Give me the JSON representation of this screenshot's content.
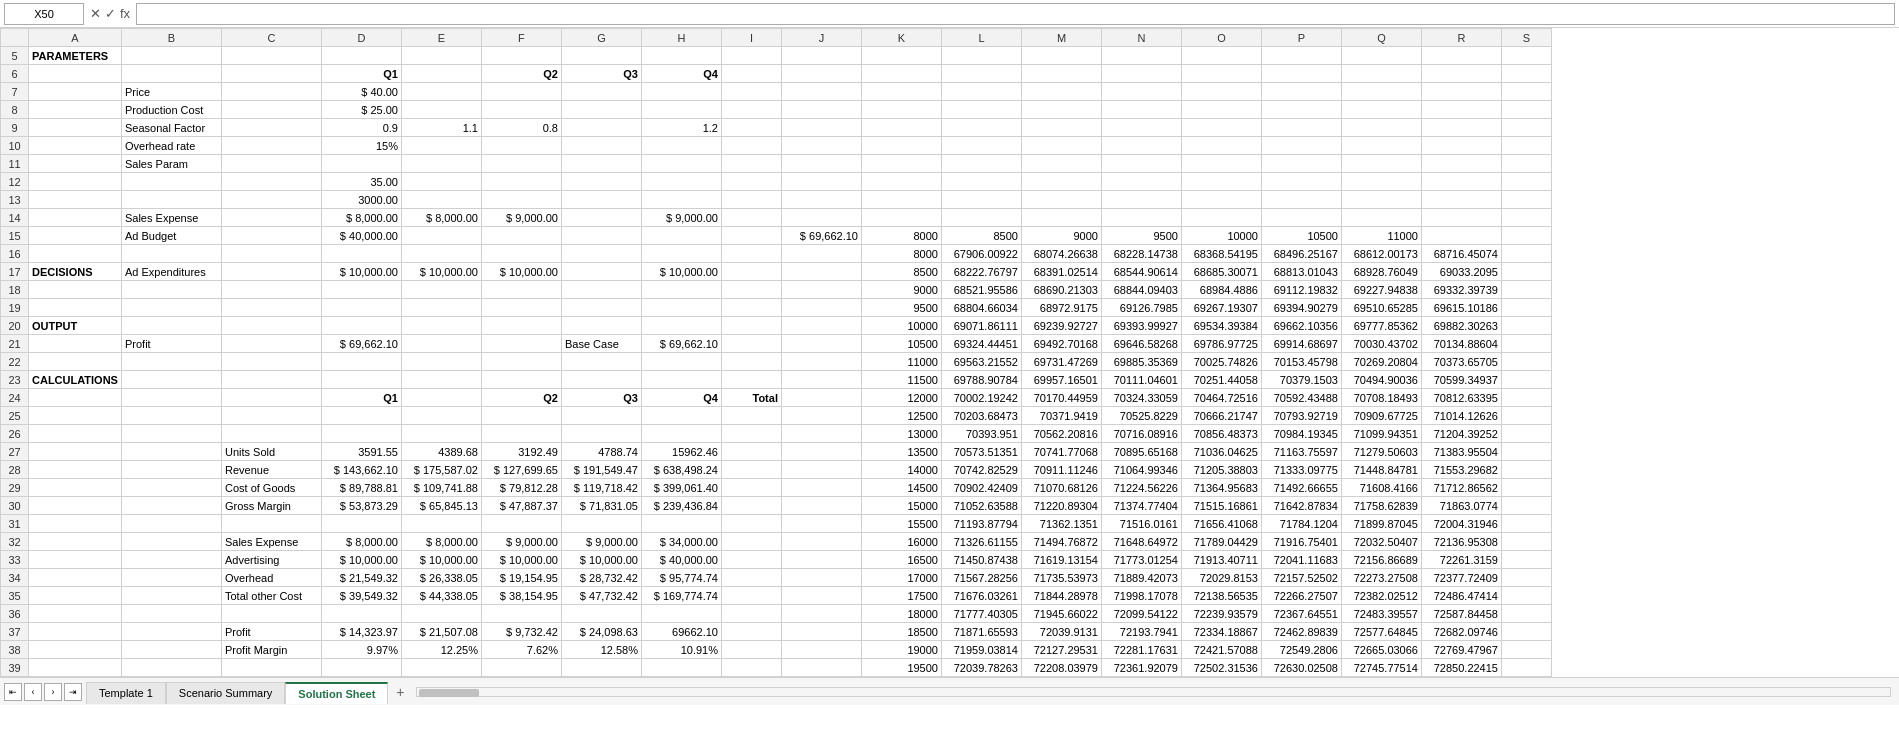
{
  "formulaBar": {
    "nameBox": "X50",
    "cancelIcon": "✕",
    "confirmIcon": "✓",
    "functionIcon": "fx",
    "formula": ""
  },
  "tabs": [
    {
      "id": "template1",
      "label": "Template 1",
      "active": false
    },
    {
      "id": "scenario-summary",
      "label": "Scenario Summary",
      "active": false
    },
    {
      "id": "solution-sheet",
      "label": "Solution Sheet",
      "active": true
    }
  ],
  "columns": [
    "",
    "A",
    "B",
    "C",
    "D",
    "E",
    "F",
    "G",
    "H",
    "I",
    "J",
    "K",
    "L",
    "M",
    "N",
    "O",
    "P",
    "Q",
    "R",
    "S"
  ],
  "rows": {
    "5": {
      "A": "PARAMETERS"
    },
    "6": {
      "D": "Q1",
      "F": "Q2",
      "G": "Q3",
      "H": "Q4"
    },
    "7": {
      "B": "Price",
      "D": "$    40.00"
    },
    "8": {
      "B": "Production Cost",
      "D": "$    25.00"
    },
    "9": {
      "B": "Seasonal Factor",
      "D": "0.9",
      "E": "1.1",
      "F": "0.8",
      "H": "1.2"
    },
    "10": {
      "B": "Overhead rate",
      "D": "15%"
    },
    "11": {
      "B": "Sales Param"
    },
    "12": {
      "D": "35.00"
    },
    "13": {
      "D": "3000.00"
    },
    "14": {
      "B": "Sales Expense",
      "D": "$  8,000.00",
      "E": "$  8,000.00",
      "F": "$  9,000.00",
      "H": "$  9,000.00"
    },
    "15": {
      "B": "Ad Budget",
      "D": "$ 40,000.00",
      "J": "$  69,662.10",
      "K": "8000",
      "L": "8500",
      "M": "9000",
      "N": "9500",
      "O": "10000",
      "P": "10500",
      "Q": "11000"
    },
    "16": {
      "K": "8000",
      "L": "67906.00922",
      "M": "68074.26638",
      "N": "68228.14738",
      "O": "68368.54195",
      "P": "68496.25167",
      "Q": "68612.00173",
      "R": "68716.45074"
    },
    "17": {
      "A": "DECISIONS",
      "B": "Ad Expenditures",
      "D": "$ 10,000.00",
      "E": "$ 10,000.00",
      "F": "$ 10,000.00",
      "H": "$ 10,000.00",
      "K": "8500",
      "L": "68222.76797",
      "M": "68391.02514",
      "N": "68544.90614",
      "O": "68685.30071",
      "P": "68813.01043",
      "Q": "68928.76049",
      "R": "69033.2095"
    },
    "18": {
      "K": "9000",
      "L": "68521.95586",
      "M": "68690.21303",
      "N": "68844.09403",
      "O": "68984.4886",
      "P": "69112.19832",
      "Q": "69227.94838",
      "R": "69332.39739"
    },
    "19": {
      "K": "9500",
      "L": "68804.66034",
      "M": "68972.9175",
      "N": "69126.7985",
      "O": "69267.19307",
      "P": "69394.90279",
      "Q": "69510.65285",
      "R": "69615.10186"
    },
    "20": {
      "A": "OUTPUT",
      "K": "10000",
      "L": "69071.86111",
      "M": "69239.92727",
      "N": "69393.99927",
      "O": "69534.39384",
      "P": "69662.10356",
      "Q": "69777.85362",
      "R": "69882.30263"
    },
    "21": {
      "B": "Profit",
      "D": "$  69,662.10",
      "G": "Base Case",
      "H": "$  69,662.10",
      "K": "10500",
      "L": "69324.44451",
      "M": "69492.70168",
      "N": "69646.58268",
      "O": "69786.97725",
      "P": "69914.68697",
      "Q": "70030.43702",
      "R": "70134.88604"
    },
    "22": {
      "K": "11000",
      "L": "69563.21552",
      "M": "69731.47269",
      "N": "69885.35369",
      "O": "70025.74826",
      "P": "70153.45798",
      "Q": "70269.20804",
      "R": "70373.65705"
    },
    "23": {
      "A": "CALCULATIONS",
      "K": "11500",
      "L": "69788.90784",
      "M": "69957.16501",
      "N": "70111.04601",
      "O": "70251.44058",
      "P": "70379.1503",
      "Q": "70494.90036",
      "R": "70599.34937"
    },
    "24": {
      "D": "Q1",
      "F": "Q2",
      "G": "Q3",
      "H": "Q4",
      "I": "Total",
      "K": "12000",
      "L": "70002.19242",
      "M": "70170.44959",
      "N": "70324.33059",
      "O": "70464.72516",
      "P": "70592.43488",
      "Q": "70708.18493",
      "R": "70812.63395"
    },
    "25": {
      "K": "12500",
      "L": "70203.68473",
      "M": "70371.9419",
      "N": "70525.8229",
      "O": "70666.21747",
      "P": "70793.92719",
      "Q": "70909.67725",
      "R": "71014.12626"
    },
    "26": {
      "K": "13000",
      "L": "70393.951",
      "M": "70562.20816",
      "N": "70716.08916",
      "O": "70856.48373",
      "P": "70984.19345",
      "Q": "71099.94351",
      "R": "71204.39252"
    },
    "27": {
      "C": "Units Sold",
      "D": "3591.55",
      "E": "4389.68",
      "F": "3192.49",
      "G": "4788.74",
      "H": "15962.46",
      "K": "13500",
      "L": "70573.51351",
      "M": "70741.77068",
      "N": "70895.65168",
      "O": "71036.04625",
      "P": "71163.75597",
      "Q": "71279.50603",
      "R": "71383.95504"
    },
    "28": {
      "C": "Revenue",
      "D": "$ 143,662.10",
      "E": "$ 175,587.02",
      "F": "$ 127,699.65",
      "G": "$ 191,549.47",
      "H": "$ 638,498.24",
      "K": "14000",
      "L": "70742.82529",
      "M": "70911.11246",
      "N": "71064.99346",
      "O": "71205.38803",
      "P": "71333.09775",
      "Q": "71448.84781",
      "R": "71553.29682"
    },
    "29": {
      "C": "Cost of Goods",
      "D": "$  89,788.81",
      "E": "$ 109,741.88",
      "F": "$  79,812.28",
      "G": "$ 119,718.42",
      "H": "$ 399,061.40",
      "K": "14500",
      "L": "70902.42409",
      "M": "71070.68126",
      "N": "71224.56226",
      "O": "71364.95683",
      "P": "71492.66655",
      "Q": "71608.4166",
      "R": "71712.86562"
    },
    "30": {
      "C": "Gross Margin",
      "D": "$  53,873.29",
      "E": "$  65,845.13",
      "F": "$  47,887.37",
      "G": "$  71,831.05",
      "H": "$ 239,436.84",
      "K": "15000",
      "L": "71052.63588",
      "M": "71220.89304",
      "N": "71374.77404",
      "O": "71515.16861",
      "P": "71642.87834",
      "Q": "71758.62839",
      "R": "71863.0774"
    },
    "31": {
      "K": "15500",
      "L": "71193.87794",
      "M": "71362.1351",
      "N": "71516.0161",
      "O": "71656.41068",
      "P": "71784.1204",
      "Q": "71899.87045",
      "R": "72004.31946"
    },
    "32": {
      "C": "Sales Expense",
      "D": "$   8,000.00",
      "E": "$   8,000.00",
      "F": "$   9,000.00",
      "G": "$   9,000.00",
      "H": "$  34,000.00",
      "K": "16000",
      "L": "71326.61155",
      "M": "71494.76872",
      "N": "71648.64972",
      "O": "71789.04429",
      "P": "71916.75401",
      "Q": "72032.50407",
      "R": "72136.95308"
    },
    "33": {
      "C": "Advertising",
      "D": "$  10,000.00",
      "E": "$  10,000.00",
      "F": "$  10,000.00",
      "G": "$  10,000.00",
      "H": "$  40,000.00",
      "K": "16500",
      "L": "71450.87438",
      "M": "71619.13154",
      "N": "71773.01254",
      "O": "71913.40711",
      "P": "72041.11683",
      "Q": "72156.86689",
      "R": "72261.3159"
    },
    "34": {
      "C": "Overhead",
      "D": "$  21,549.32",
      "E": "$  26,338.05",
      "F": "$  19,154.95",
      "G": "$  28,732.42",
      "H": "$  95,774.74",
      "K": "17000",
      "L": "71567.28256",
      "M": "71735.53973",
      "N": "71889.42073",
      "O": "72029.8153",
      "P": "72157.52502",
      "Q": "72273.27508",
      "R": "72377.72409"
    },
    "35": {
      "C": "Total other Cost",
      "D": "$  39,549.32",
      "E": "$  44,338.05",
      "F": "$  38,154.95",
      "G": "$  47,732.42",
      "H": "$ 169,774.74",
      "K": "17500",
      "L": "71676.03261",
      "M": "71844.28978",
      "N": "71998.17078",
      "O": "72138.56535",
      "P": "72266.27507",
      "Q": "72382.02512",
      "R": "72486.47414"
    },
    "36": {
      "K": "18000",
      "L": "71777.40305",
      "M": "71945.66022",
      "N": "72099.54122",
      "O": "72239.93579",
      "P": "72367.64551",
      "Q": "72483.39557",
      "R": "72587.84458"
    },
    "37": {
      "C": "Profit",
      "D": "$  14,323.97",
      "E": "$  21,507.08",
      "F": "$   9,732.42",
      "G": "$  24,098.63",
      "H": "69662.10",
      "K": "18500",
      "L": "71871.65593",
      "M": "72039.9131",
      "N": "72193.7941",
      "O": "72334.18867",
      "P": "72462.89839",
      "Q": "72577.64845",
      "R": "72682.09746"
    },
    "38": {
      "C": "Profit Margin",
      "D": "9.97%",
      "E": "12.25%",
      "F": "7.62%",
      "G": "12.58%",
      "H": "10.91%",
      "K": "19000",
      "L": "71959.03814",
      "M": "72127.29531",
      "N": "72281.17631",
      "O": "72421.57088",
      "P": "72549.2806",
      "Q": "72665.03066",
      "R": "72769.47967"
    },
    "39": {
      "K": "19500",
      "L": "72039.78263",
      "M": "72208.03979",
      "N": "72361.92079",
      "O": "72502.31536",
      "P": "72630.02508",
      "Q": "72745.77514",
      "R": "72850.22415"
    }
  },
  "accent": "#217346",
  "tabAddLabel": "+"
}
